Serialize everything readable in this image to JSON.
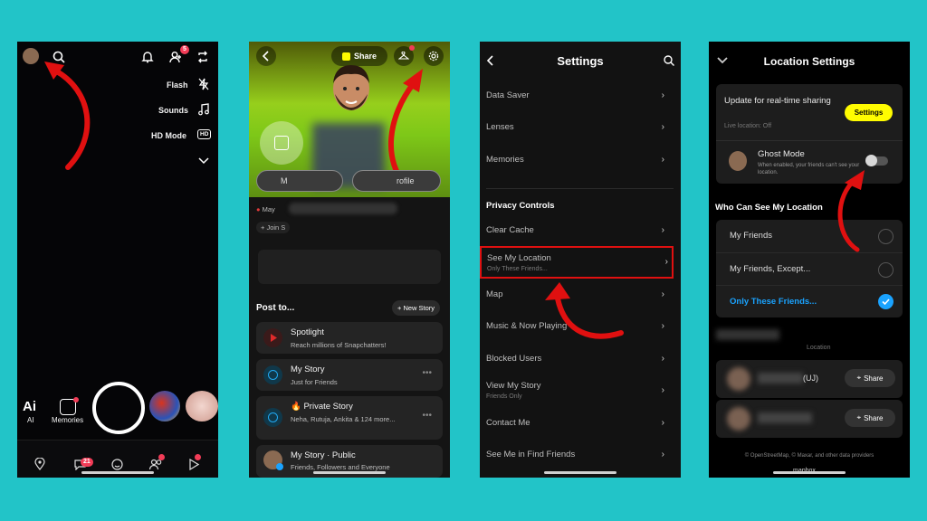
{
  "colors": {
    "background": "#22c4c8",
    "accent_red": "#e01010",
    "snap_yellow": "#fffc00",
    "selected_blue": "#1aa3ff"
  },
  "camera": {
    "notif_badge": "5",
    "flash": "Flash",
    "sounds": "Sounds",
    "hd_mode": "HD Mode",
    "hd_icon": "HD",
    "ai_icon": "Ai",
    "ai": "AI",
    "memories": "Memories",
    "chat_badge": "21"
  },
  "profile": {
    "share": "Share",
    "btn_left": "M",
    "btn_right": "rofile",
    "chip1": "May",
    "join": "+ Join S",
    "post_to": "Post to...",
    "new_story": "+ New Story",
    "items": [
      {
        "title": "Spotlight",
        "sub": "Reach millions of Snapchatters!",
        "icon": "play-icon"
      },
      {
        "title": "My Story",
        "sub": "Just for Friends",
        "icon": "camera-icon"
      },
      {
        "title": "🔥 Private Story",
        "sub": "Neha, Rutuja, Ankita & 124 more...",
        "icon": "camera-icon"
      },
      {
        "title": "My Story · Public",
        "sub": "Friends, Followers and Everyone",
        "icon": "avatar-icon"
      }
    ]
  },
  "settings": {
    "title": "Settings",
    "rows": [
      {
        "label": "Data Saver"
      },
      {
        "label": "Lenses"
      },
      {
        "label": "Memories"
      }
    ],
    "section": "Privacy Controls",
    "clear_cache": "Clear Cache",
    "see_location": "See My Location",
    "see_location_sub": "Only These Friends...",
    "map": "Map",
    "music": "Music & Now Playing",
    "blocked": "Blocked Users",
    "view_story": "View My Story",
    "view_story_sub": "Friends Only",
    "contact": "Contact Me",
    "see_me": "See Me in Find Friends"
  },
  "location": {
    "title": "Location Settings",
    "update": "Update for real-time sharing",
    "live": "Live location: Off",
    "settings_btn": "Settings",
    "ghost": "Ghost Mode",
    "ghost_sub": "When enabled, your friends can't see your location.",
    "who": "Who Can See My Location",
    "opt1": "My Friends",
    "opt2": "My Friends, Except...",
    "opt3": "Only These Friends...",
    "partial1": "Location",
    "share": "Share",
    "name1": "(UJ)",
    "footer": "© OpenStreetMap, © Maxar, and other data providers",
    "mapbox": "mapbox"
  }
}
